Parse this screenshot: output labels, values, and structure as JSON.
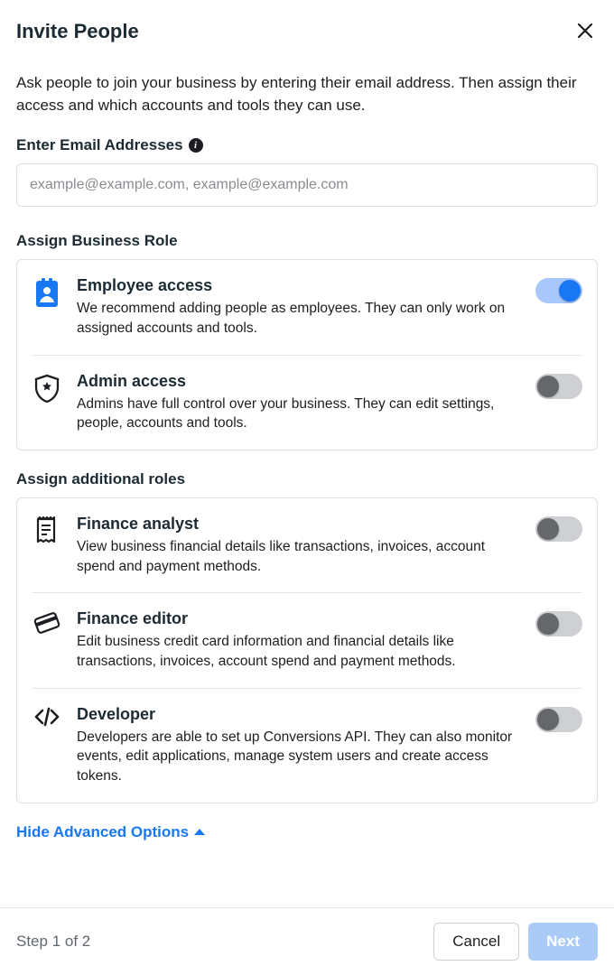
{
  "dialog": {
    "title": "Invite People",
    "intro": "Ask people to join your business by entering their email address. Then assign their access and which accounts and tools they can use."
  },
  "email": {
    "label": "Enter Email Addresses",
    "placeholder": "example@example.com, example@example.com",
    "value": ""
  },
  "business_role": {
    "label": "Assign Business Role",
    "roles": [
      {
        "title": "Employee access",
        "desc": "We recommend adding people as employees. They can only work on assigned accounts and tools.",
        "enabled": true
      },
      {
        "title": "Admin access",
        "desc": "Admins have full control over your business. They can edit settings, people, accounts and tools.",
        "enabled": false
      }
    ]
  },
  "additional_roles": {
    "label": "Assign additional roles",
    "roles": [
      {
        "title": "Finance analyst",
        "desc": "View business financial details like transactions, invoices, account spend and payment methods.",
        "enabled": false
      },
      {
        "title": "Finance editor",
        "desc": "Edit business credit card information and financial details like transactions, invoices, account spend and payment methods.",
        "enabled": false
      },
      {
        "title": "Developer",
        "desc": "Developers are able to set up Conversions API. They can also monitor events, edit applications, manage system users and create access tokens.",
        "enabled": false
      }
    ]
  },
  "advanced": {
    "link_text": "Hide Advanced Options"
  },
  "footer": {
    "step_text": "Step 1 of 2",
    "cancel": "Cancel",
    "next": "Next"
  },
  "colors": {
    "accent": "#1877f2"
  }
}
